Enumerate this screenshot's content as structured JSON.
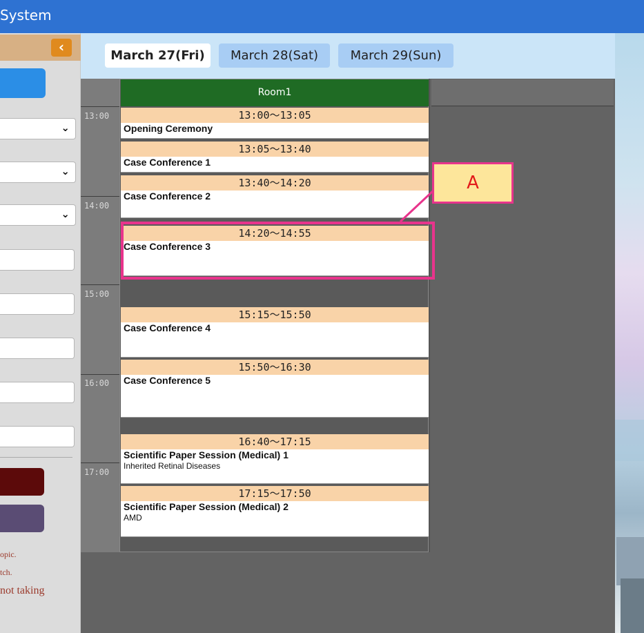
{
  "app": {
    "title": "System"
  },
  "sidebar": {
    "collapse_icon": "‹",
    "notes": [
      "opic.",
      "tch.",
      "not taking"
    ]
  },
  "tabs": [
    {
      "label": "March 27(Fri)",
      "active": true
    },
    {
      "label": "March 28(Sat)",
      "active": false
    },
    {
      "label": "March 29(Sun)",
      "active": false
    }
  ],
  "room": {
    "name": "Room1"
  },
  "time_labels": [
    "13:00",
    "14:00",
    "15:00",
    "16:00",
    "17:00"
  ],
  "sessions": [
    {
      "time": "13:00〜13:05",
      "title": "Opening Ceremony",
      "subtitle": ""
    },
    {
      "time": "13:05〜13:40",
      "title": "Case Conference 1",
      "subtitle": ""
    },
    {
      "time": "13:40〜14:20",
      "title": "Case Conference 2",
      "subtitle": ""
    },
    {
      "time": "14:20〜14:55",
      "title": "Case Conference 3",
      "subtitle": ""
    },
    {
      "time": "15:15〜15:50",
      "title": "Case Conference 4",
      "subtitle": ""
    },
    {
      "time": "15:50〜16:30",
      "title": "Case Conference 5",
      "subtitle": ""
    },
    {
      "time": "16:40〜17:15",
      "title": "Scientific Paper Session (Medical) 1",
      "subtitle": "Inherited Retinal Diseases"
    },
    {
      "time": "17:15〜17:50",
      "title": "Scientific Paper Session (Medical) 2",
      "subtitle": "AMD"
    }
  ],
  "annotation": {
    "label": "A",
    "color": "#e8348c"
  },
  "colors": {
    "topbar": "#2e72d2",
    "room_header": "#1f6b24",
    "session_time_bg": "#f9d3a8",
    "active_tab": "#ffffff",
    "inactive_tab": "#a8cdf4"
  }
}
